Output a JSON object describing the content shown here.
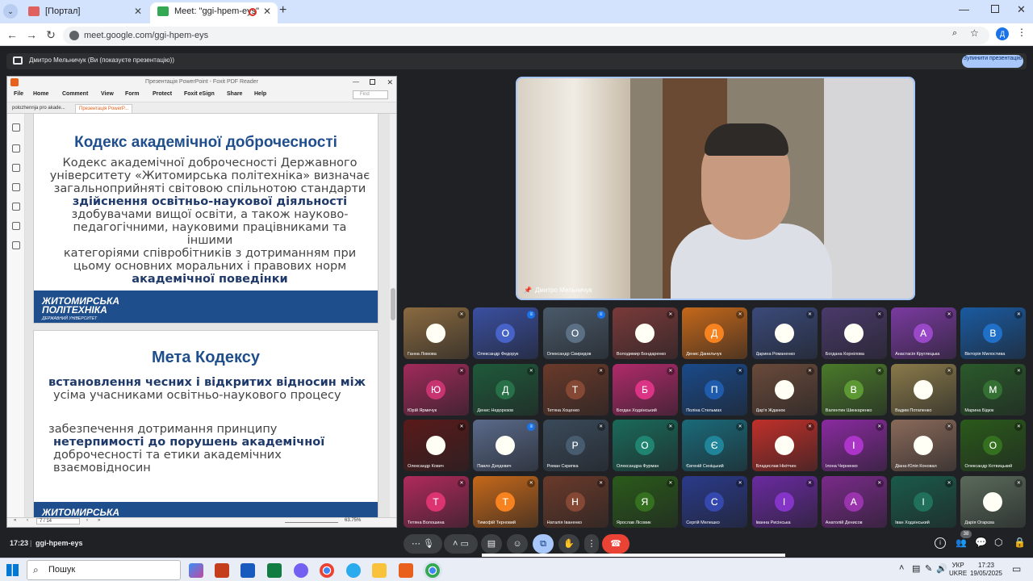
{
  "browser": {
    "tabs": [
      {
        "label": "[Портал]",
        "active": false
      },
      {
        "label": "Meet: \"ggi-hpem-eys\"",
        "active": true
      }
    ],
    "url": "meet.google.com/ggi-hpem-eys",
    "profile_initial": "Д"
  },
  "meet": {
    "presenting_label": "Дмитро Мельничук (Ви (показуєте презентацію))",
    "stop_button": "Зупинити презентацію",
    "speaker_name": "Дмитро Мельничук",
    "time": "17:23",
    "meeting_code": "ggi-hpem-eys",
    "participant_count": "38",
    "participants": [
      {
        "name": "Ганна Ломова",
        "initial": "",
        "color": "#8a6a40",
        "photo": true,
        "muted": true
      },
      {
        "name": "Олександр Федорук",
        "initial": "О",
        "color": "#3a4fa0",
        "muted": false
      },
      {
        "name": "Олександр Свиридов",
        "initial": "О",
        "color": "#4a5a6a",
        "muted": false
      },
      {
        "name": "Володимир Бондаренко",
        "initial": "",
        "color": "#7a3a3a",
        "photo": true,
        "muted": true
      },
      {
        "name": "Денис Данильчук",
        "initial": "Д",
        "color": "#c5681a",
        "muted": true
      },
      {
        "name": "Дарина Романенко",
        "initial": "",
        "color": "#3a4a7a",
        "photo": true,
        "muted": true
      },
      {
        "name": "Богдана Корнілова",
        "initial": "",
        "color": "#4a3a6a",
        "photo": true,
        "muted": true
      },
      {
        "name": "Анастасія Круглецька",
        "initial": "А",
        "color": "#7a3aa0",
        "muted": true
      },
      {
        "name": "Вікторія Милостива",
        "initial": "В",
        "color": "#1a5aa0",
        "muted": true
      },
      {
        "name": "Юрій Ярмечук",
        "initial": "Ю",
        "color": "#a02a5a",
        "muted": true
      },
      {
        "name": "Денис Недорезов",
        "initial": "Д",
        "color": "#1f5a3a",
        "muted": true
      },
      {
        "name": "Тетяна Хоценко",
        "initial": "Т",
        "color": "#6a3a2a",
        "muted": true
      },
      {
        "name": "Богдан Ходзінський",
        "initial": "Б",
        "color": "#b02a6a",
        "muted": true
      },
      {
        "name": "Поліна Стельмах",
        "initial": "П",
        "color": "#1a4a8a",
        "muted": true
      },
      {
        "name": "Дар'я Жданюк",
        "initial": "",
        "color": "#6a4a3a",
        "photo": true,
        "muted": true
      },
      {
        "name": "Валентин Шинкаренко",
        "initial": "В",
        "color": "#4a7a2a",
        "muted": true
      },
      {
        "name": "Вадим Потапенко",
        "initial": "",
        "color": "#8a7a4a",
        "photo": true,
        "muted": true
      },
      {
        "name": "Марина Бідюк",
        "initial": "М",
        "color": "#2a5a2a",
        "muted": true
      },
      {
        "name": "Олександр Кович",
        "initial": "",
        "color": "#5a1a1a",
        "photo": true,
        "muted": true
      },
      {
        "name": "Павло Дзядевич",
        "initial": "",
        "color": "#5a6a8a",
        "photo": true,
        "muted": false
      },
      {
        "name": "Роман Скрипка",
        "initial": "Р",
        "color": "#3a4a5a",
        "muted": true
      },
      {
        "name": "Олександра Фурман",
        "initial": "О",
        "color": "#1a6a5a",
        "muted": true
      },
      {
        "name": "Євгеній Сеніцький",
        "initial": "Є",
        "color": "#1a6a7a",
        "muted": true
      },
      {
        "name": "Владислав Нікітчин",
        "initial": "",
        "color": "#c0302a",
        "photo": true,
        "muted": true
      },
      {
        "name": "Ілона Черненко",
        "initial": "І",
        "color": "#8a2aa0",
        "muted": true
      },
      {
        "name": "Діана-Юлія Коновал",
        "initial": "",
        "color": "#8a6a5a",
        "photo": true,
        "muted": true
      },
      {
        "name": "Олександр Котвицький",
        "initial": "О",
        "color": "#2a5a1a",
        "muted": true
      },
      {
        "name": "Тетяна Волошина",
        "initial": "Т",
        "color": "#b02a5a",
        "muted": true
      },
      {
        "name": "Тимофій Терновий",
        "initial": "Т",
        "color": "#c5681a",
        "muted": true
      },
      {
        "name": "Наталія Іваненко",
        "initial": "Н",
        "color": "#6a3a2a",
        "muted": true
      },
      {
        "name": "Ярослав Лісовик",
        "initial": "Я",
        "color": "#2a5a1a",
        "muted": true
      },
      {
        "name": "Сергій Мелешко",
        "initial": "С",
        "color": "#2a3a8a",
        "muted": true
      },
      {
        "name": "Іванна Рисінська",
        "initial": "І",
        "color": "#6a2aa0",
        "muted": true
      },
      {
        "name": "Анатолій Денисов",
        "initial": "А",
        "color": "#7a2a8a",
        "muted": true
      },
      {
        "name": "Іван Ходзінський",
        "initial": "І",
        "color": "#1a5a4a",
        "muted": true
      },
      {
        "name": "Дарія Огарєва",
        "initial": "",
        "color": "#5a6a5a",
        "photo": true,
        "muted": true
      }
    ]
  },
  "pdf": {
    "window_title": "Презентація PowerPoint - Foxit PDF Reader",
    "menu": [
      "File",
      "Home",
      "Comment",
      "View",
      "Form",
      "Protect",
      "Foxit eSign",
      "Share",
      "Help"
    ],
    "find_placeholder": "Find",
    "doc_tabs": [
      "polozhennja pro akade...",
      "Презентація PowerP..."
    ],
    "page_indicator": "7 / 14",
    "zoom": "63.75%",
    "slide1": {
      "title": "Кодекс академічної доброчесності",
      "lines": [
        "Кодекс академічної доброчесності Державного",
        "університету «Житомирська політехніка» визначає",
        "загальноприйняті світовою спільнотою стандарти",
        "здійснення освітньо-наукової діяльності",
        "здобувачами вищої освіти, а також науково-",
        "педагогічними, науковими працівниками та іншими",
        "категоріями співробітників з дотриманням при",
        "цьому основних моральних і правових норм",
        "академічної поведінки"
      ]
    },
    "logo": {
      "line1": "ЖИТОМИРСЬКА",
      "line2": "ПОЛІТЕХНІКА",
      "sub": "ДЕРЖАВНИЙ УНІВЕРСИТЕТ",
      "cut_line1": "ЖИТОМИРСЬКА"
    },
    "slide2": {
      "title": "Мета Кодексу",
      "b1": [
        "встановлення чесних і відкритих відносин між",
        "усіма учасниками освітньо-наукового процесу"
      ],
      "b2": [
        "забезпечення дотримання принципу",
        "нетерпимості до порушень академічної",
        "доброчесності та етики академічних",
        "взаємовідносин"
      ]
    }
  },
  "taskbar": {
    "search": "Пошук",
    "lang": "УКР",
    "lang2": "UKRE",
    "time": "17:23",
    "date": "19/05/2025"
  }
}
